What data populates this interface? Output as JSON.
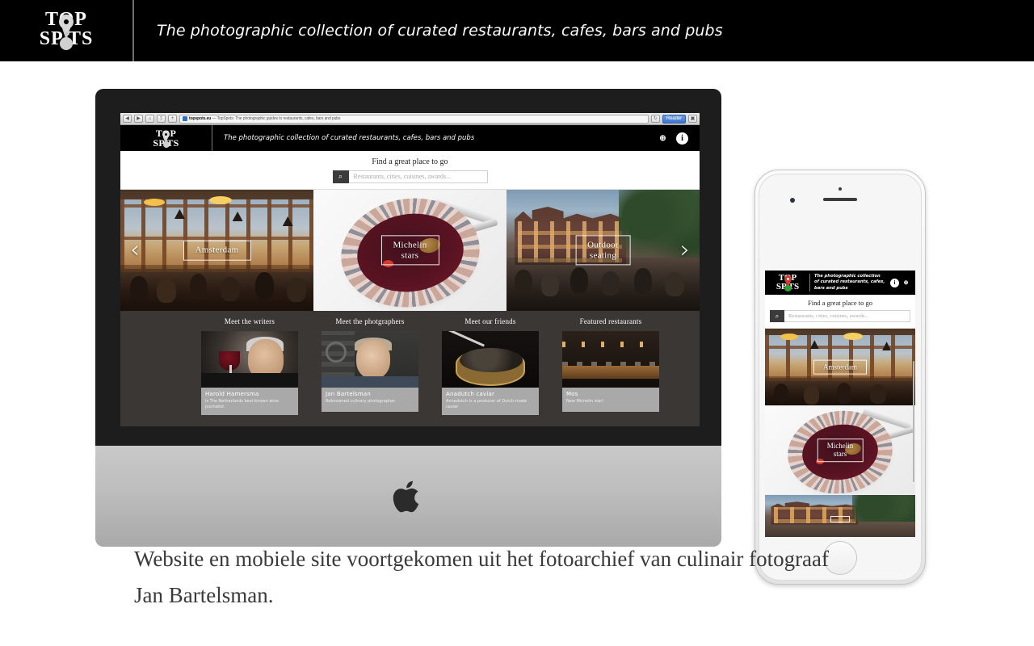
{
  "topbar": {
    "logo": {
      "line1": "TOP",
      "line2": "SP TS",
      "alt": "top-spots-logo"
    },
    "tagline": "The photographic collection of curated restaurants, cafes, bars and pubs"
  },
  "imac": {
    "browser": {
      "back_icon": "◀",
      "forward_icon": "▶",
      "home_icon": "⌂",
      "share_icon": "⇪",
      "add_icon": "+",
      "url": "topspots.eu",
      "url_title": " — TopSpots: The photographic guides to restaurants, cafes, bars and pubs",
      "reader_label": "Reader",
      "reload_icon": "↻",
      "tabs_icon": "▣"
    },
    "site_header": {
      "logo_line1": "TOP",
      "logo_line2": "SP TS",
      "tagline": "The photographic collection of curated restaurants, cafes, bars and pubs",
      "globe_icon": "⊕",
      "info_icon": "i"
    },
    "search": {
      "title": "Find a great place to go",
      "placeholder": "Restaurants, cities, cuisines, awards...",
      "button_icon": "⌕"
    },
    "carousel": {
      "prev_icon": "‹",
      "next_icon": "›",
      "tiles": [
        {
          "label": "Amsterdam",
          "scene": "brasserie-interior"
        },
        {
          "label": "Michelin\nstars",
          "scene": "michelin-plate"
        },
        {
          "label": "Outdoor\nseating",
          "scene": "terrace-street"
        }
      ]
    },
    "cards": [
      {
        "heading": "Meet the writers",
        "name": "Harold Hamersma",
        "desc": "Is The Netherlands best-known wine journalist.",
        "photo": "portrait-with-wine-glass"
      },
      {
        "heading": "Meet the photgraphers",
        "name": "Jan Bartelsman",
        "desc": "Reknowned culinary photographer",
        "photo": "portrait-photographer"
      },
      {
        "heading": "Meet our friends",
        "name": "Anadutch caviar",
        "desc": "Annadutch is a producer of Dutch-made caviar",
        "photo": "caviar-tin"
      },
      {
        "heading": "Featured restaurants",
        "name": "Mos",
        "desc": "New Michelin star!",
        "photo": "restaurant-interior"
      }
    ]
  },
  "iphone": {
    "header": {
      "logo_line1": "TOP",
      "logo_line2": "SP TS",
      "tagline": "The photographic collection\nof curated restaurants, cafes,\nbars and pubs",
      "info_icon": "i",
      "globe_icon": "⊕"
    },
    "search": {
      "title": "Find a great place to go",
      "placeholder": "Restaurants, cities, cuisines, awards...",
      "button_icon": "⌕"
    },
    "tiles": [
      {
        "label": "Amsterdam",
        "scene": "brasserie-interior"
      },
      {
        "label": "Michelin\nstars",
        "scene": "michelin-plate"
      },
      {
        "label": "",
        "scene": "terrace-street"
      }
    ]
  },
  "caption": "Website en mobiele site voortgekomen uit het fotoarchief van culinair fotograaf Jan Bartelsman.",
  "colors": {
    "brand_black": "#000000",
    "dark_band": "#3b3735",
    "caption_gray": "#3a3a3a",
    "pin_red": "#d43a2f",
    "pin_green": "#2f9c3a"
  }
}
